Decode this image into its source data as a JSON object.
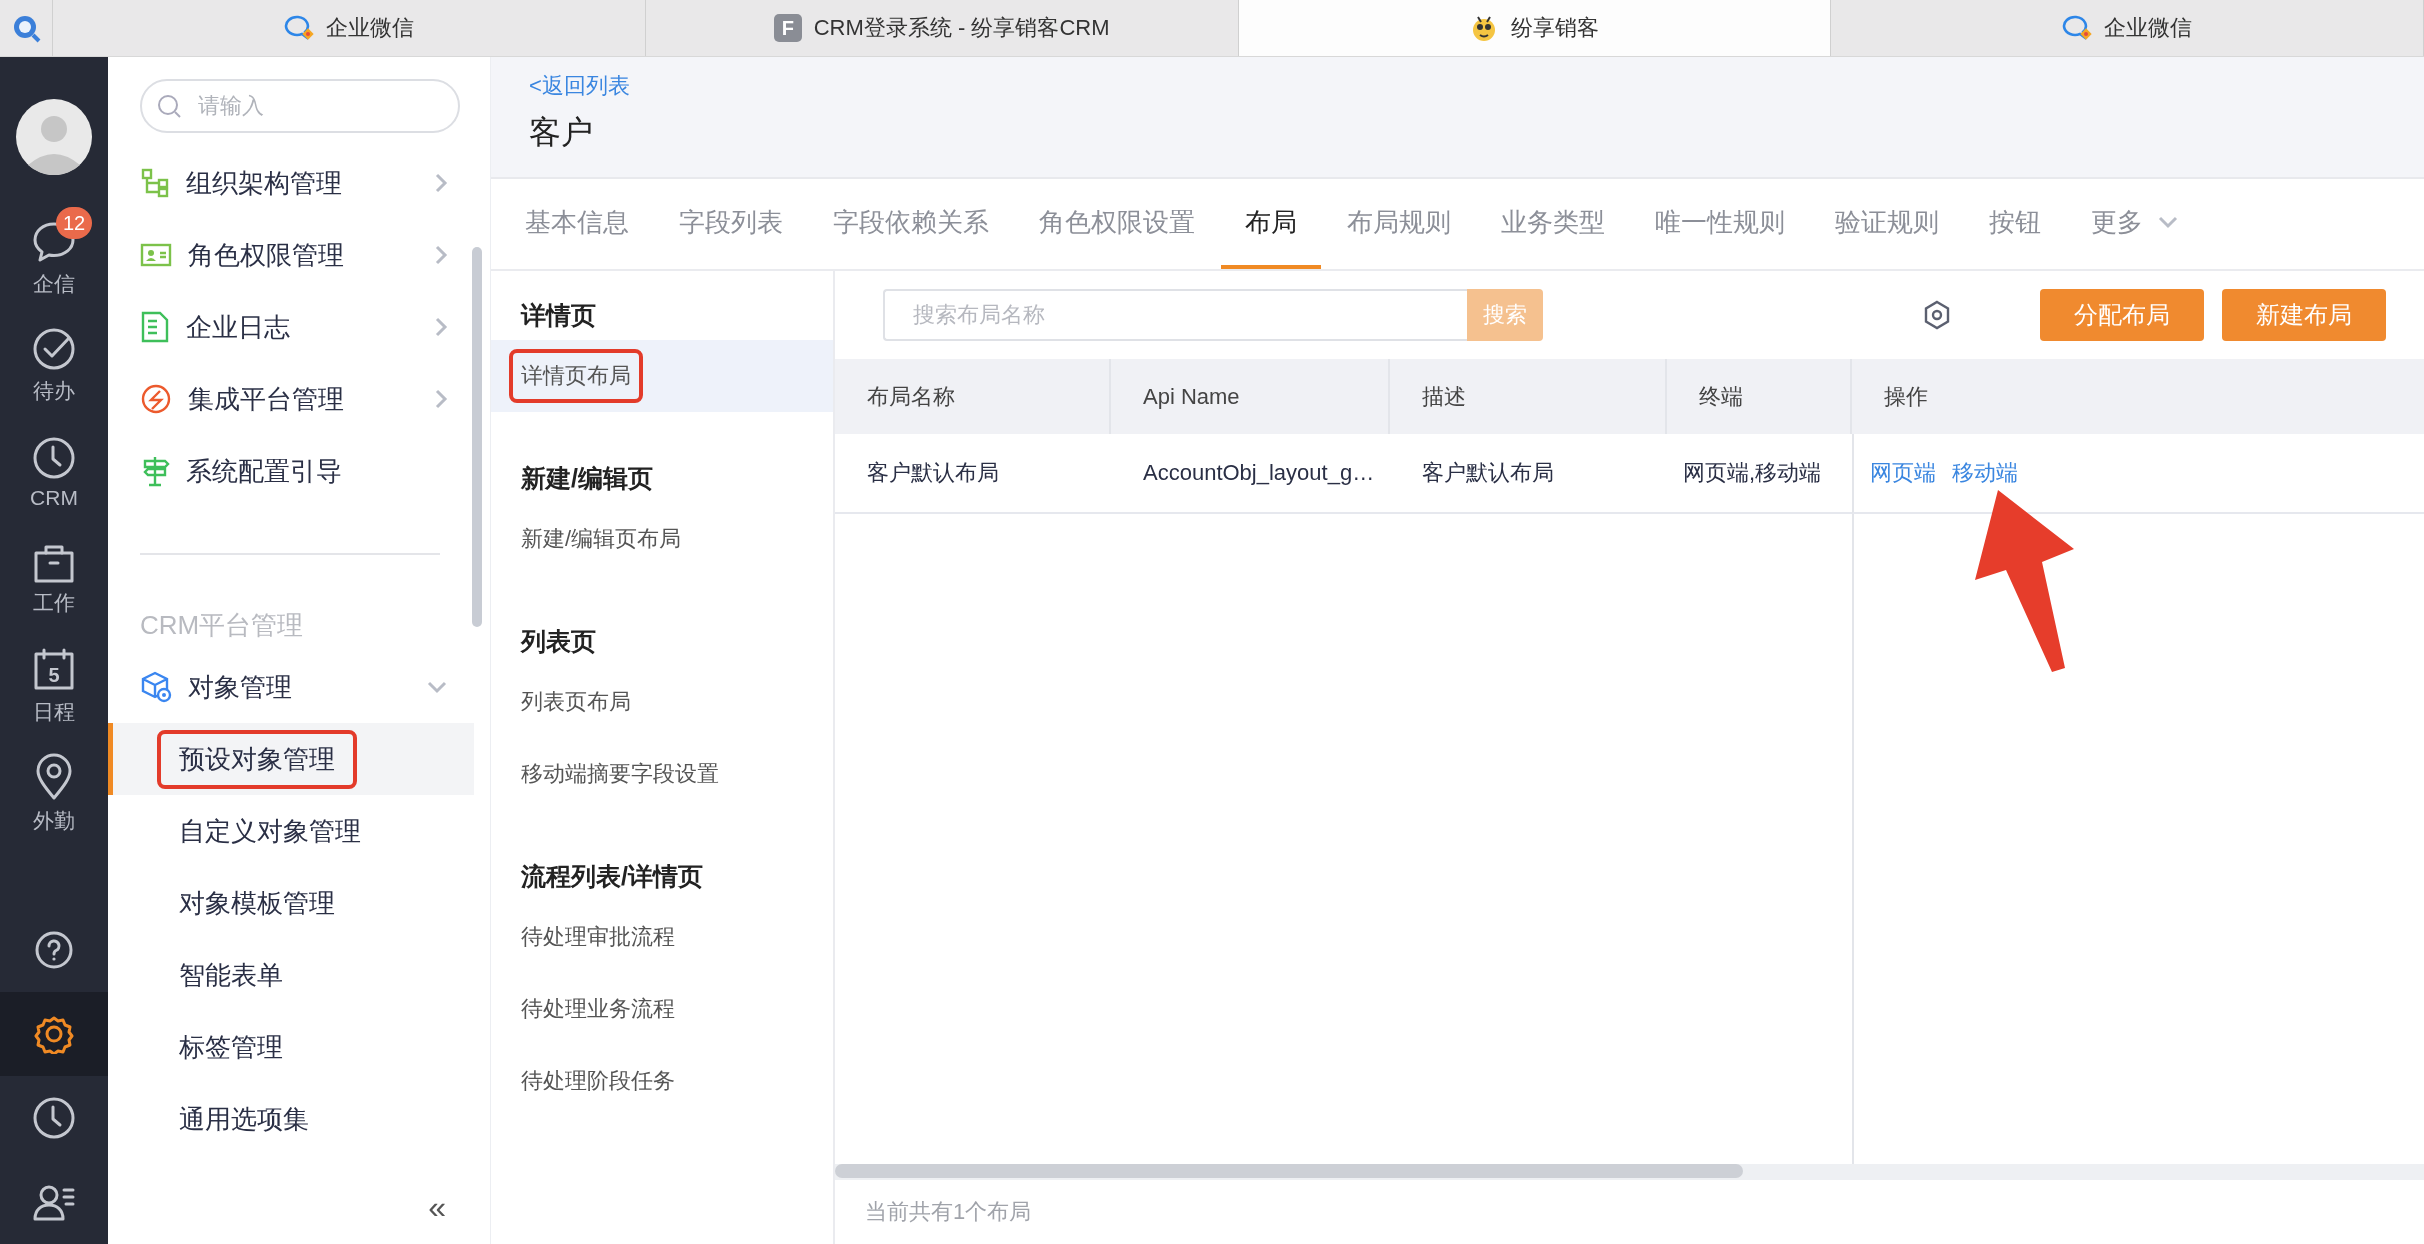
{
  "browser_tabs": [
    {
      "kind": "search-app",
      "selected": false
    },
    {
      "kind": "wecom",
      "label": "企业微信",
      "selected": false
    },
    {
      "kind": "letter",
      "glyph": "F",
      "label": "CRM登录系统 - 纷享销客CRM",
      "selected": false
    },
    {
      "kind": "mascot",
      "label": "纷享销客",
      "selected": true
    },
    {
      "kind": "wecom",
      "label": "企业微信",
      "selected": false
    }
  ],
  "rail": {
    "items": [
      {
        "kind": "chat",
        "label": "企信",
        "badge": "12",
        "selected": false
      },
      {
        "kind": "check",
        "label": "待办",
        "selected": false
      },
      {
        "kind": "clock",
        "label": "CRM",
        "selected": false
      },
      {
        "kind": "briefcase",
        "label": "工作",
        "selected": false
      },
      {
        "kind": "calendar",
        "glyph": "5",
        "label": "日程",
        "selected": false
      },
      {
        "kind": "pin",
        "label": "外勤",
        "selected": false
      }
    ],
    "bottom_items": [
      {
        "kind": "help",
        "selected": false
      },
      {
        "kind": "gear",
        "selected": true
      },
      {
        "kind": "clock",
        "selected": false
      },
      {
        "kind": "contacts",
        "selected": false
      }
    ]
  },
  "settings_menu": {
    "search": {
      "placeholder": "请输入"
    },
    "items": [
      {
        "kind": "org",
        "label": "组织架构管理",
        "expandable": true
      },
      {
        "kind": "role",
        "label": "角色权限管理",
        "expandable": true
      },
      {
        "kind": "log",
        "label": "企业日志",
        "expandable": true
      },
      {
        "kind": "integration",
        "label": "集成平台管理",
        "expandable": true
      },
      {
        "kind": "guide",
        "label": "系统配置引导",
        "expandable": false
      }
    ],
    "section_label": "CRM平台管理",
    "group": {
      "kind": "object",
      "label": "对象管理",
      "expanded": true,
      "children": [
        {
          "label": "预设对象管理",
          "selected": true,
          "highlighted": true
        },
        {
          "label": "自定义对象管理",
          "selected": false,
          "highlighted": false
        },
        {
          "label": "对象模板管理",
          "selected": false,
          "highlighted": false
        },
        {
          "label": "智能表单",
          "selected": false,
          "highlighted": false
        },
        {
          "label": "标签管理",
          "selected": false,
          "highlighted": false
        },
        {
          "label": "通用选项集",
          "selected": false,
          "highlighted": false
        }
      ]
    },
    "collapse": "«"
  },
  "header": {
    "back_link": "<返回列表",
    "title": "客户"
  },
  "tabs": [
    {
      "label": "基本信息",
      "selected": false
    },
    {
      "label": "字段列表",
      "selected": false
    },
    {
      "label": "字段依赖关系",
      "selected": false
    },
    {
      "label": "角色权限设置",
      "selected": false
    },
    {
      "label": "布局",
      "selected": true
    },
    {
      "label": "布局规则",
      "selected": false
    },
    {
      "label": "业务类型",
      "selected": false
    },
    {
      "label": "唯一性规则",
      "selected": false
    },
    {
      "label": "验证规则",
      "selected": false
    },
    {
      "label": "按钮",
      "selected": false
    },
    {
      "label": "更多",
      "selected": false,
      "dropdown": true
    }
  ],
  "subnav": [
    {
      "title": "详情页",
      "items": [
        {
          "label": "详情页布局",
          "selected": true,
          "highlighted": true
        }
      ]
    },
    {
      "title": "新建/编辑页",
      "items": [
        {
          "label": "新建/编辑页布局",
          "selected": false,
          "highlighted": false
        }
      ]
    },
    {
      "title": "列表页",
      "items": [
        {
          "label": "列表页布局",
          "selected": false,
          "highlighted": false
        },
        {
          "label": "移动端摘要字段设置",
          "selected": false,
          "highlighted": false
        }
      ]
    },
    {
      "title": "流程列表/详情页",
      "items": [
        {
          "label": "待处理审批流程",
          "selected": false,
          "highlighted": false
        },
        {
          "label": "待处理业务流程",
          "selected": false,
          "highlighted": false
        },
        {
          "label": "待处理阶段任务",
          "selected": false,
          "highlighted": false
        }
      ]
    }
  ],
  "toolbar": {
    "search": {
      "placeholder": "搜索布局名称",
      "button": "搜索"
    },
    "buttons": [
      "分配布局",
      "新建布局"
    ]
  },
  "table": {
    "columns": [
      "布局名称",
      "Api Name",
      "描述",
      "终端",
      "操作"
    ],
    "rows": [
      {
        "cells": [
          "客户默认布局",
          "AccountObj_layout_g…",
          "客户默认布局",
          "网页端,移动端"
        ],
        "actions": [
          "网页端",
          "移动端"
        ]
      }
    ]
  },
  "footer": "当前共有1个布局",
  "annotation": {
    "arrow": true
  }
}
